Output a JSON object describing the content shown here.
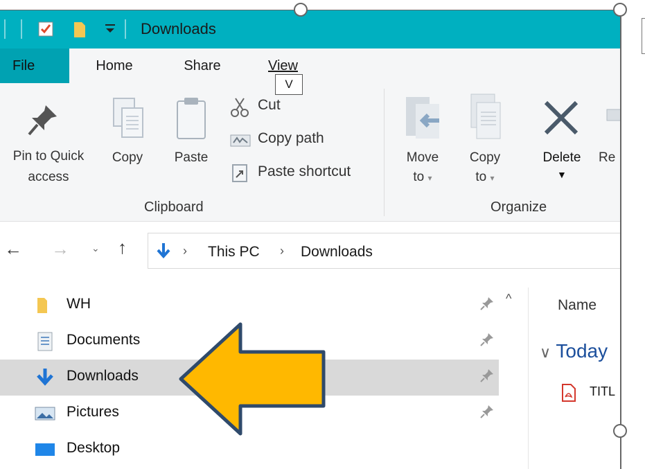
{
  "title_bar": {
    "title": "Downloads",
    "quick_access": [
      "properties-icon",
      "new-folder-icon",
      "customize-dropdown-icon"
    ]
  },
  "tabs": {
    "file": "File",
    "home": "Home",
    "share": "Share",
    "view": "View",
    "view_keytip": "V"
  },
  "ribbon": {
    "clipboard": {
      "pin": [
        "Pin to Quick",
        "access"
      ],
      "copy": "Copy",
      "paste": "Paste",
      "cut": "Cut",
      "copy_path": "Copy path",
      "paste_shortcut": "Paste shortcut",
      "group_label": "Clipboard"
    },
    "organize": {
      "move_to": [
        "Move",
        "to"
      ],
      "copy_to": [
        "Copy",
        "to"
      ],
      "delete": "Delete",
      "rename_partial": "Re",
      "group_label": "Organize"
    }
  },
  "address": {
    "crumbs": [
      "This PC",
      "Downloads"
    ]
  },
  "nav_pane": {
    "items": [
      {
        "label": "WH",
        "icon": "folder-icon",
        "pinned": true,
        "selected": false
      },
      {
        "label": "Documents",
        "icon": "documents-icon",
        "pinned": true,
        "selected": false
      },
      {
        "label": "Downloads",
        "icon": "download-arrow-icon",
        "pinned": true,
        "selected": true
      },
      {
        "label": "Pictures",
        "icon": "pictures-icon",
        "pinned": true,
        "selected": false
      },
      {
        "label": "Desktop",
        "icon": "desktop-icon",
        "pinned": false,
        "selected": false
      }
    ]
  },
  "content": {
    "column_name": "Name",
    "group": "Today",
    "file_partial": "TITL"
  },
  "colors": {
    "title_bar": "#00b0c0",
    "arrow_fill": "#ffb800",
    "arrow_stroke": "#2f4a6b",
    "selection": "#d9d9d9"
  }
}
